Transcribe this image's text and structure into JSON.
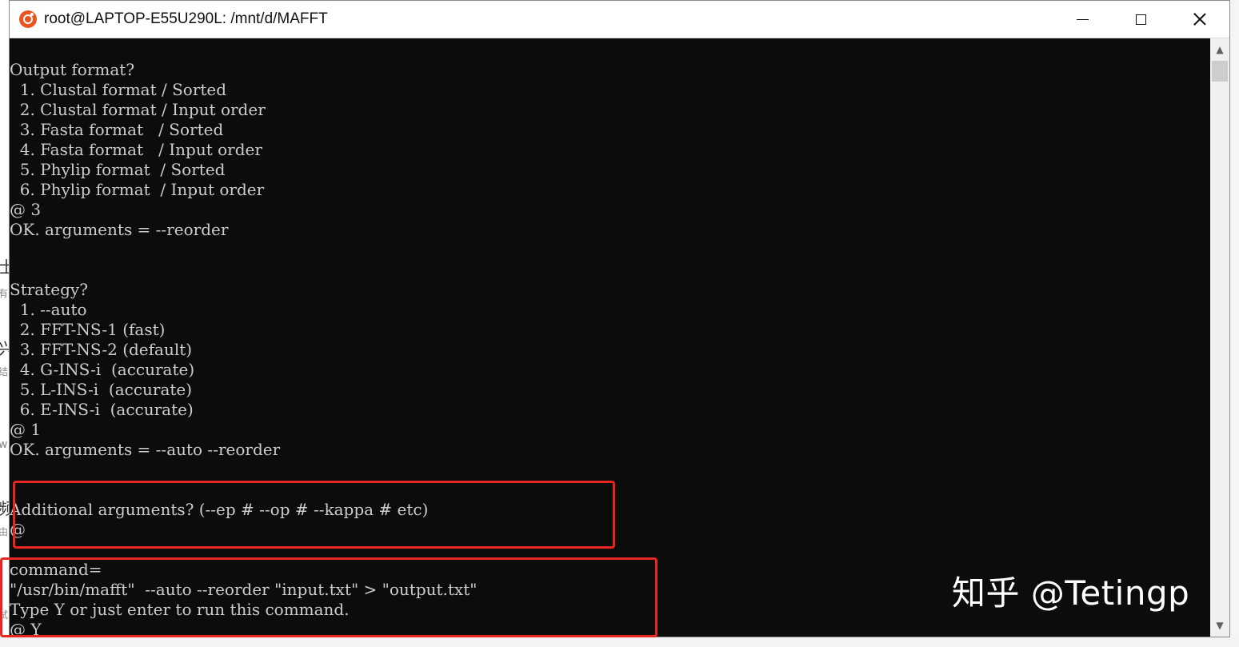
{
  "window": {
    "title": "root@LAPTOP-E55U290L: /mnt/d/MAFFT"
  },
  "background_glyphs": [
    "士",
    "有",
    "兴",
    "结",
    "w",
    "频",
    "由",
    "试"
  ],
  "terminal": {
    "lines": [
      "Output format?",
      "  1. Clustal format / Sorted",
      "  2. Clustal format / Input order",
      "  3. Fasta format   / Sorted",
      "  4. Fasta format   / Input order",
      "  5. Phylip format  / Sorted",
      "  6. Phylip format  / Input order",
      "@ 3",
      "OK. arguments = --reorder",
      "",
      "",
      "Strategy?",
      "  1. --auto",
      "  2. FFT-NS-1 (fast)",
      "  3. FFT-NS-2 (default)",
      "  4. G-INS-i  (accurate)",
      "  5. L-INS-i  (accurate)",
      "  6. E-INS-i  (accurate)",
      "@ 1",
      "OK. arguments = --auto --reorder",
      "",
      "",
      "Additional arguments? (--ep # --op # --kappa # etc)",
      "@",
      "",
      "command=",
      "\"/usr/bin/mafft\"  --auto --reorder \"input.txt\" > \"output.txt\"",
      "Type Y or just enter to run this command.",
      "@ Y_"
    ]
  },
  "watermark": "知乎 @Tetingp",
  "colors": {
    "terminal_bg": "#0c0c0c",
    "terminal_fg": "#cccccc",
    "highlight_box": "#e8251f",
    "ubuntu_icon": "#e95420"
  }
}
